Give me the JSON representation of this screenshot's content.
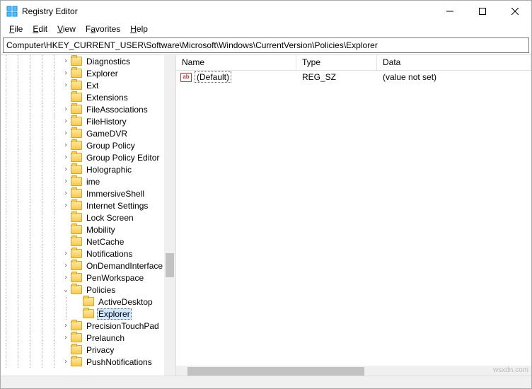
{
  "window": {
    "title": "Registry Editor"
  },
  "menu": {
    "file": "File",
    "edit": "Edit",
    "view": "View",
    "favorites": "Favorites",
    "help": "Help"
  },
  "address": {
    "path": "Computer\\HKEY_CURRENT_USER\\Software\\Microsoft\\Windows\\CurrentVersion\\Policies\\Explorer"
  },
  "tree": {
    "items": [
      {
        "depth": 5,
        "exp": "closed",
        "label": "Diagnostics"
      },
      {
        "depth": 5,
        "exp": "closed",
        "label": "Explorer"
      },
      {
        "depth": 5,
        "exp": "closed",
        "label": "Ext"
      },
      {
        "depth": 5,
        "exp": "none",
        "label": "Extensions"
      },
      {
        "depth": 5,
        "exp": "closed",
        "label": "FileAssociations"
      },
      {
        "depth": 5,
        "exp": "closed",
        "label": "FileHistory"
      },
      {
        "depth": 5,
        "exp": "closed",
        "label": "GameDVR"
      },
      {
        "depth": 5,
        "exp": "closed",
        "label": "Group Policy"
      },
      {
        "depth": 5,
        "exp": "closed",
        "label": "Group Policy Editor"
      },
      {
        "depth": 5,
        "exp": "closed",
        "label": "Holographic"
      },
      {
        "depth": 5,
        "exp": "closed",
        "label": "ime"
      },
      {
        "depth": 5,
        "exp": "closed",
        "label": "ImmersiveShell"
      },
      {
        "depth": 5,
        "exp": "closed",
        "label": "Internet Settings"
      },
      {
        "depth": 5,
        "exp": "none",
        "label": "Lock Screen"
      },
      {
        "depth": 5,
        "exp": "none",
        "label": "Mobility"
      },
      {
        "depth": 5,
        "exp": "none",
        "label": "NetCache"
      },
      {
        "depth": 5,
        "exp": "closed",
        "label": "Notifications"
      },
      {
        "depth": 5,
        "exp": "closed",
        "label": "OnDemandInterface"
      },
      {
        "depth": 5,
        "exp": "closed",
        "label": "PenWorkspace"
      },
      {
        "depth": 5,
        "exp": "open",
        "label": "Policies"
      },
      {
        "depth": 6,
        "exp": "none",
        "label": "ActiveDesktop"
      },
      {
        "depth": 6,
        "exp": "none",
        "label": "Explorer",
        "selected": true
      },
      {
        "depth": 5,
        "exp": "closed",
        "label": "PrecisionTouchPad"
      },
      {
        "depth": 5,
        "exp": "closed",
        "label": "Prelaunch"
      },
      {
        "depth": 5,
        "exp": "none",
        "label": "Privacy"
      },
      {
        "depth": 5,
        "exp": "closed",
        "label": "PushNotifications"
      }
    ]
  },
  "list": {
    "columns": {
      "name": "Name",
      "type": "Type",
      "data": "Data"
    },
    "rows": [
      {
        "icon": "string",
        "name": "(Default)",
        "type": "REG_SZ",
        "data": "(value not set)"
      }
    ]
  },
  "watermark": "wsxdn.com"
}
